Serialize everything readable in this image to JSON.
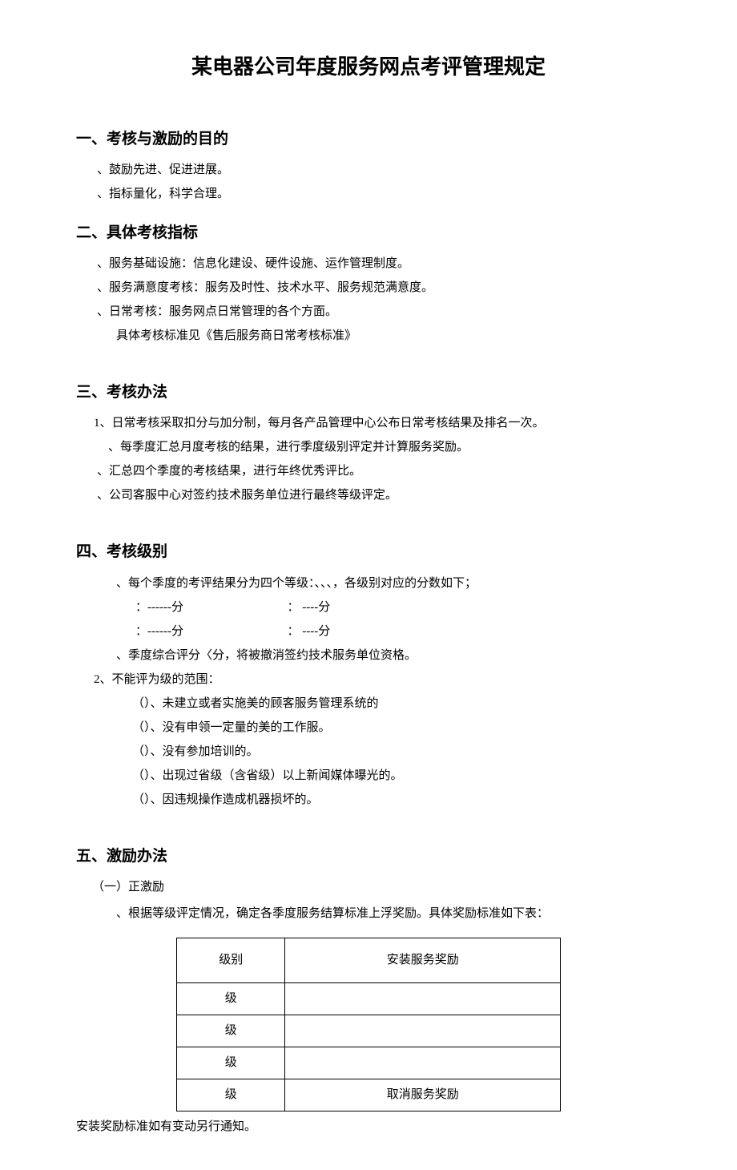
{
  "title": "某电器公司年度服务网点考评管理规定",
  "s1": {
    "heading": "一、考核与激励的目的",
    "i1": "、鼓励先进、促进进展。",
    "i2": "、指标量化，科学合理。"
  },
  "s2": {
    "heading": "二、具体考核指标",
    "i1": "、服务基础设施：信息化建设、硬件设施、运作管理制度。",
    "i2": "、服务满意度考核：服务及时性、技术水平、服务规范满意度。",
    "i3": "、日常考核：服务网点日常管理的各个方面。",
    "i4": "具体考核标准见《售后服务商日常考核标准》"
  },
  "s3": {
    "heading": "三、考核办法",
    "i1": "1、日常考核采取扣分与加分制，每月各产品管理中心公布日常考核结果及排名一次。",
    "i2": "、每季度汇总月度考核的结果，进行季度级别评定并计算服务奖励。",
    "i3": "、汇总四个季度的考核结果，进行年终优秀评比。",
    "i4": "、公司客服中心对签约技术服务单位进行最终等级评定。"
  },
  "s4": {
    "heading": "四、考核级别",
    "i1": "、每个季度的考评结果分为四个等级：、、、，各级别对应的分数如下；",
    "score1a": "：------分",
    "score1b": "：  ----分",
    "score2a": "：------分",
    "score2b": "：  ----分",
    "i2": "、季度综合评分〈分，将被撤消签约技术服务单位资格。",
    "i3": "2、不能评为级的范围：",
    "p1": "（）、未建立或者实施美的顾客服务管理系统的",
    "p2": "（）、没有申领一定量的美的工作服。",
    "p3": "（）、没有参加培训的。",
    "p4": "（）、出现过省级（含省级）以上新闻媒体曝光的。",
    "p5": "（）、因违规操作造成机器损坏的。"
  },
  "s5": {
    "heading": "五、激励办法",
    "sub1": "（一）正激励",
    "i1": "、根据等级评定情况，确定各季度服务结算标准上浮奖励。具体奖励标准如下表：",
    "table": {
      "h1": "级别",
      "h2": "安装服务奖励",
      "r1c1": "级",
      "r1c2": "",
      "r2c1": "级",
      "r2c2": "",
      "r3c1": "级",
      "r3c2": "",
      "r4c1": "级",
      "r4c2": "取消服务奖励"
    },
    "footnote": "安装奖励标准如有变动另行通知。"
  }
}
